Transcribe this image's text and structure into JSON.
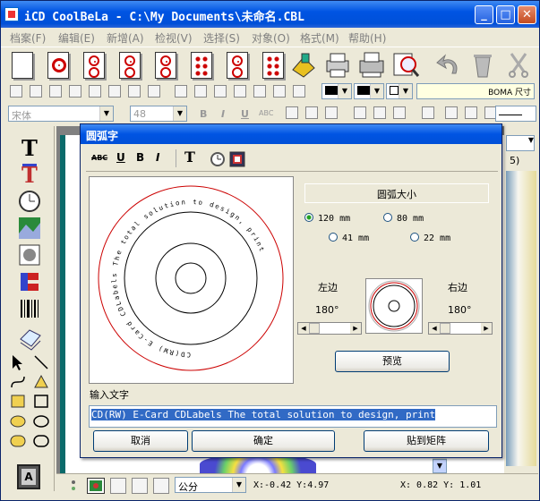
{
  "window": {
    "title": "iCD CoolBeLa - C:\\My Documents\\未命名.CBL"
  },
  "menu": [
    "档案(F)",
    "编辑(E)",
    "新增(A)",
    "检视(V)",
    "选择(S)",
    "对象(O)",
    "格式(M)",
    "帮助(H)"
  ],
  "toolbar2": {
    "paper_label": "BOMA 尺寸"
  },
  "toolbar3": {
    "font": "宋体",
    "size": "48",
    "bold": "B",
    "italic": "I",
    "underline": "U",
    "abc": "ABC"
  },
  "status": {
    "unit": "公分",
    "coord_x": "X:-0.42 Y:4.97",
    "coord_y": "X: 0.82 Y: 1.01"
  },
  "right_hint": "5)",
  "dialog": {
    "title": "圆弧字",
    "toolbar": {
      "abc": "ABC",
      "u": "U",
      "b": "B",
      "i": "I",
      "t": "T"
    },
    "size_group": "圆弧大小",
    "radios": [
      {
        "label": "120 mm",
        "checked": true
      },
      {
        "label": "80 mm",
        "checked": false
      },
      {
        "label": "41 mm",
        "checked": false
      },
      {
        "label": "22 mm",
        "checked": false
      }
    ],
    "left_label": "左边",
    "right_label": "右边",
    "left_angle": "180°",
    "right_angle": "180°",
    "preview_button": "预览",
    "input_label": "输入文字",
    "input_value": "CD(RW) E-Card CDLabels The total solution to design, print",
    "cancel_button": "取消",
    "ok_button": "确定",
    "paste_button": "贴到矩阵"
  },
  "colors": {
    "title_blue": "#0054E3",
    "arc_red": "#CC0000"
  }
}
